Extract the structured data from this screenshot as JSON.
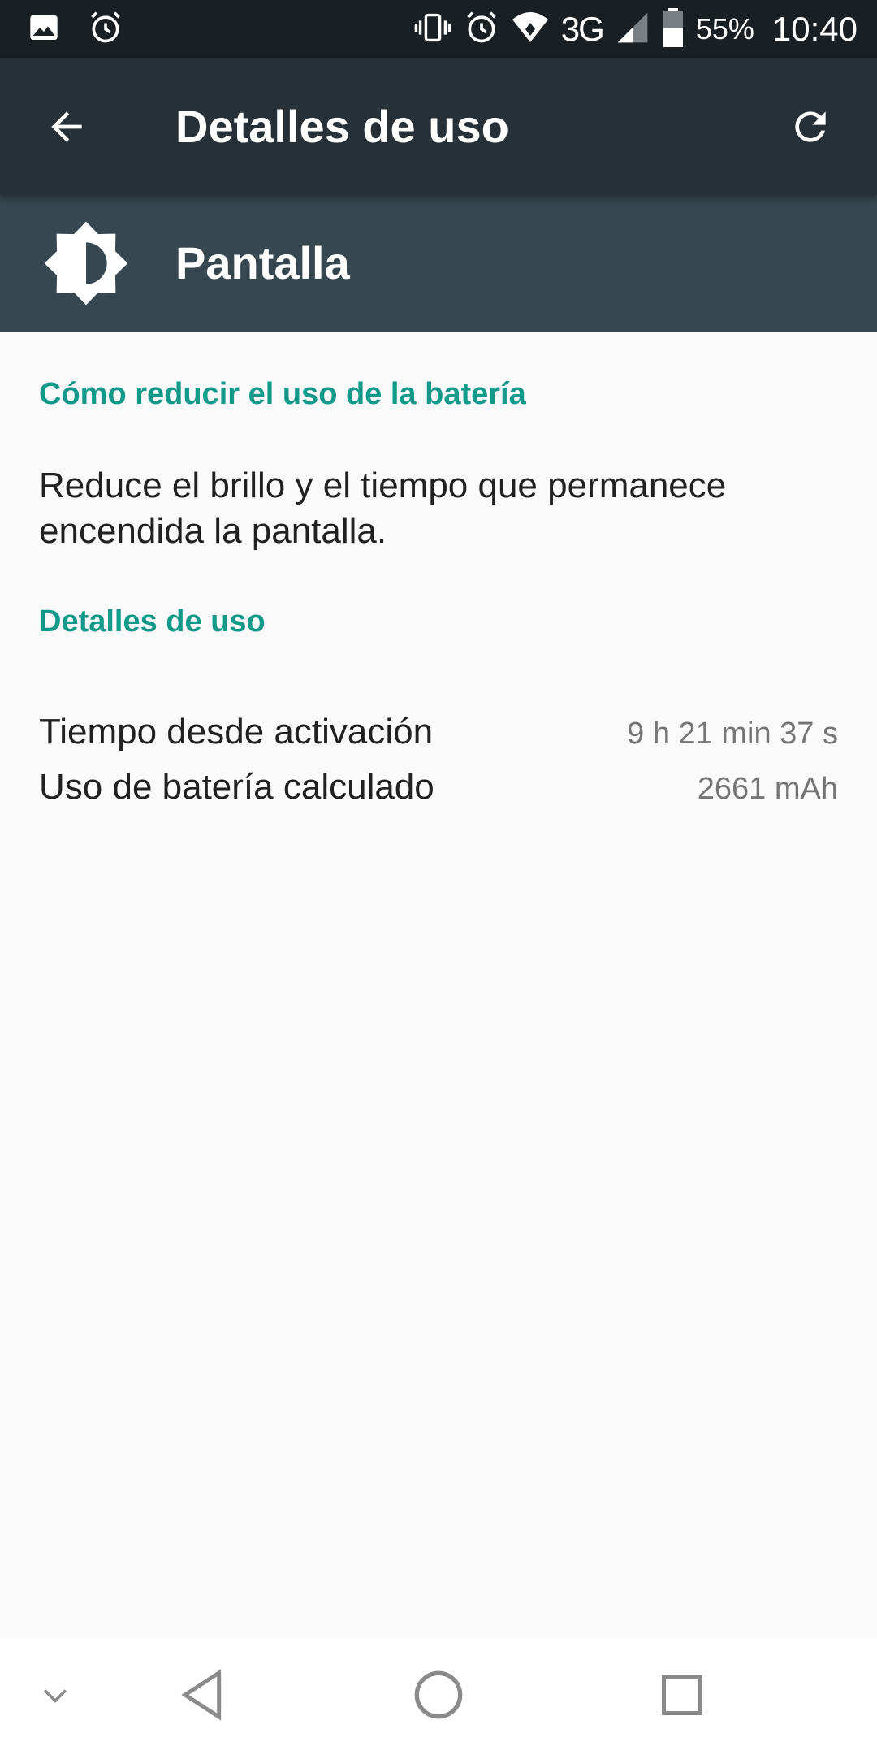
{
  "status_bar": {
    "battery_percent": "55%",
    "time": "10:40",
    "network": "3G",
    "icons": [
      "image-icon",
      "alarm-icon",
      "vibrate-icon",
      "alarm-icon",
      "wifi-icon",
      "signal-icon",
      "battery-icon"
    ]
  },
  "app_bar": {
    "title": "Detalles de uso",
    "back_icon": "arrow-back-icon",
    "refresh_icon": "refresh-icon"
  },
  "header": {
    "label": "Pantalla",
    "icon": "brightness-icon"
  },
  "tips": {
    "heading": "Cómo reducir el uso de la batería",
    "text": "Reduce el brillo y el tiempo que permanece encendida la pantalla."
  },
  "usage": {
    "heading": "Detalles de uso",
    "rows": [
      {
        "label": "Tiempo desde activación",
        "value": "9 h 21 min 37 s"
      },
      {
        "label": "Uso de batería calculado",
        "value": "2661 mAh"
      }
    ]
  },
  "nav_bar": {
    "icons": [
      "chevron-down-icon",
      "nav-back-icon",
      "nav-home-icon",
      "nav-recents-icon"
    ]
  },
  "colors": {
    "status_bar": "#1a1f23",
    "app_bar": "#263036",
    "header_band": "#37474f",
    "accent": "#13998a",
    "background": "#fafafa"
  }
}
